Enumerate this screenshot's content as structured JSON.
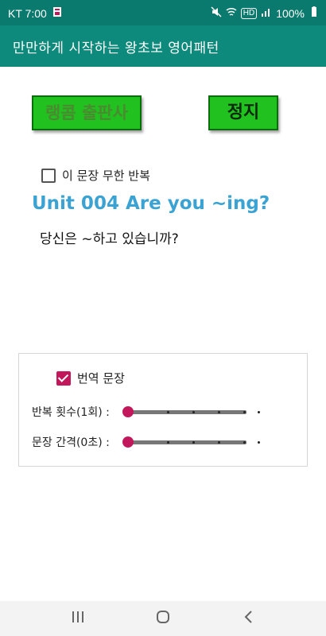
{
  "status_bar": {
    "carrier_time": "KT 7:00",
    "battery": "100%",
    "hd": "HD",
    "icons": [
      "notification-icon",
      "mute-icon",
      "wifi-icon",
      "signal-icon",
      "battery-icon"
    ]
  },
  "app_bar": {
    "title": "만만하게 시작하는 왕초보 영어패턴"
  },
  "buttons": {
    "publisher": "랭콤 출판사",
    "stop": "정지"
  },
  "repeat_checkbox": {
    "label": "이 문장 무한 반복",
    "checked": false
  },
  "unit": {
    "title": "Unit 004 Are you ~ing?",
    "translation": "당신은 ~하고 있습니까?"
  },
  "panel": {
    "translation_checkbox": {
      "label": "번역 문장",
      "checked": true
    },
    "repeat_slider": {
      "label": "반복 횟수(1회) :",
      "value": 1,
      "fraction": 0.0
    },
    "interval_slider": {
      "label": "문장 간격(0초) :",
      "value": 0,
      "fraction": 0.0
    }
  },
  "colors": {
    "status_bar": "#0a7a6e",
    "app_bar": "#0e8a7c",
    "button_green": "#21c21f",
    "accent": "#c2185b",
    "unit_title": "#3aa3d3"
  },
  "nav_bar": {
    "icons": [
      "recent-apps-icon",
      "home-icon",
      "back-icon"
    ]
  }
}
